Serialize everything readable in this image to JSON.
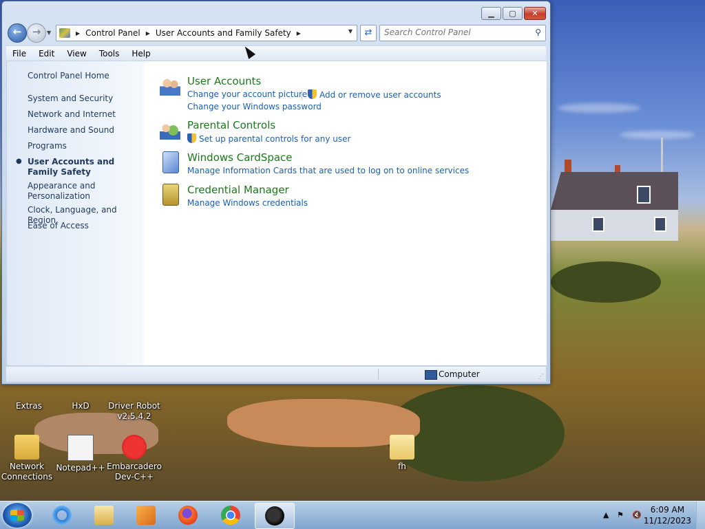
{
  "window": {
    "address_crumbs": [
      "Control Panel",
      "User Accounts and Family Safety"
    ],
    "search_placeholder": "Search Control Panel",
    "menu": [
      "File",
      "Edit",
      "View",
      "Tools",
      "Help"
    ]
  },
  "sidebar": {
    "home": "Control Panel Home",
    "items": [
      {
        "label": "System and Security"
      },
      {
        "label": "Network and Internet"
      },
      {
        "label": "Hardware and Sound"
      },
      {
        "label": "Programs"
      },
      {
        "label": "User Accounts and Family Safety",
        "current": true
      },
      {
        "label": "Appearance and Personalization"
      },
      {
        "label": "Clock, Language, and Region"
      },
      {
        "label": "Ease of Access"
      }
    ]
  },
  "categories": [
    {
      "title": "User Accounts",
      "icon": "user-accounts-icon",
      "links": [
        "Change your account picture",
        "Add or remove user accounts",
        "Change your Windows password"
      ]
    },
    {
      "title": "Parental Controls",
      "icon": "parental-controls-icon",
      "links": [
        "Set up parental controls for any user"
      ]
    },
    {
      "title": "Windows CardSpace",
      "icon": "cardspace-icon",
      "links": [
        "Manage Information Cards that are used to log on to online services"
      ]
    },
    {
      "title": "Credential Manager",
      "icon": "credential-manager-icon",
      "links": [
        "Manage Windows credentials"
      ]
    }
  ],
  "status": {
    "zone": "Computer"
  },
  "desktop_icons": [
    {
      "label": "Extras"
    },
    {
      "label": "HxD"
    },
    {
      "label": "Driver Robot v2.5.4.2"
    },
    {
      "label": "Network Connections"
    },
    {
      "label": "Notepad++"
    },
    {
      "label": "Embarcadero Dev-C++"
    },
    {
      "label": "fh"
    }
  ],
  "taskbar": {
    "apps": [
      "internet-explorer-icon",
      "file-explorer-icon",
      "media-player-icon",
      "firefox-icon",
      "chrome-icon",
      "active-app-icon"
    ],
    "time": "6:09 AM",
    "date": "11/12/2023"
  }
}
